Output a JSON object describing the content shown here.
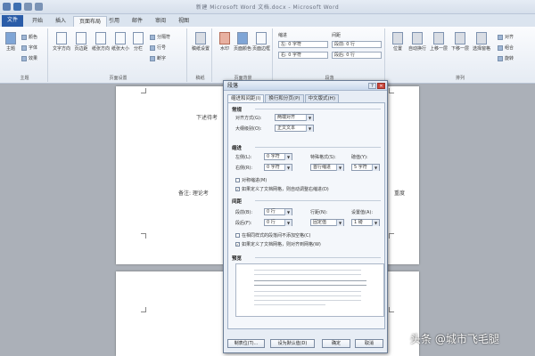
{
  "window": {
    "title": "新建 Microsoft Word 文档.docx - Microsoft Word"
  },
  "tabs": [
    "文件",
    "开始",
    "插入",
    "页面布局",
    "引用",
    "邮件",
    "审阅",
    "视图"
  ],
  "ribbon": {
    "theme": {
      "btn": "主题",
      "items": [
        "颜色",
        "字体",
        "效果"
      ],
      "group": "主题"
    },
    "page_setup": {
      "btns": [
        "文字方向",
        "页边距",
        "纸张方向",
        "纸张大小",
        "分栏"
      ],
      "smalls": [
        "分隔符",
        "行号",
        "断字"
      ],
      "group": "页面设置"
    },
    "manuscript": {
      "btn": "稿纸设置",
      "group": "稿纸"
    },
    "bg": {
      "btns": [
        "水印",
        "页面颜色",
        "页面边框"
      ],
      "group": "页面背景"
    },
    "indent": {
      "label": "缩进",
      "left": "左: 0 字符",
      "right": "右: 0 字符"
    },
    "spacing": {
      "label": "间距",
      "before": "段前: 0 行",
      "after": "段后: 0 行"
    },
    "group_para": "段落",
    "arrange": {
      "btns": [
        "位置",
        "自动换行",
        "上移一层",
        "下移一层",
        "选择窗格"
      ],
      "smalls": [
        "对齐",
        "组合",
        "旋转"
      ],
      "group": "排列"
    }
  },
  "document": {
    "line1": "下述待考",
    "line2": "备注: 理论考",
    "line2_end": "重度"
  },
  "dialog": {
    "title": "段落",
    "tabs": [
      "缩进和间距(I)",
      "换行和分页(P)",
      "中文版式(H)"
    ],
    "general": {
      "title": "常规",
      "align_label": "对齐方式(G):",
      "align_value": "两端对齐",
      "outline_label": "大纲级别(O):",
      "outline_value": "正文文本"
    },
    "indent": {
      "title": "缩进",
      "left_label": "左侧(L):",
      "left_value": "0 字符",
      "right_label": "右侧(R):",
      "right_value": "0 字符",
      "special_label": "特殊格式(S):",
      "special_value": "首行缩进",
      "by_label": "磅值(Y):",
      "by_value": "5 字符",
      "mirror": "对称缩进(M)",
      "auto": "如果定义了文档网格，则自动调整右缩进(D)"
    },
    "spacing": {
      "title": "间距",
      "before_label": "段前(B):",
      "before_value": "0 行",
      "after_label": "段后(F):",
      "after_value": "0 行",
      "line_label": "行距(N):",
      "line_value": "固定值",
      "at_label": "设置值(A):",
      "at_value": "1 磅",
      "nosame": "在相同样式的段落间不添加空格(C)",
      "snap": "如果定义了文档网格，则对齐到网格(W)"
    },
    "preview": {
      "title": "预览"
    },
    "buttons": {
      "tabs": "制表位(T)...",
      "default": "设为默认值(D)",
      "ok": "确定",
      "cancel": "取消"
    }
  },
  "watermark": "头条 @城市飞毛腿"
}
